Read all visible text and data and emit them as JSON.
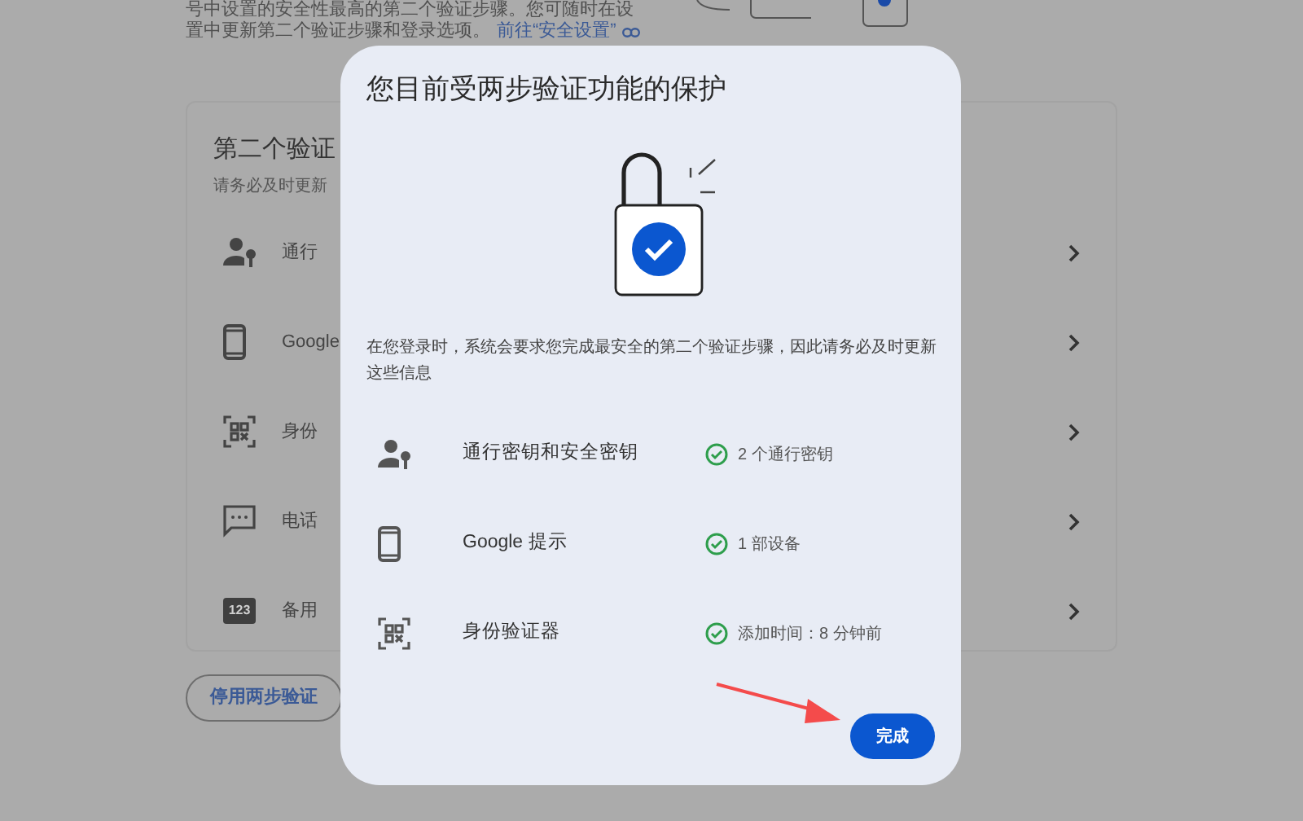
{
  "page": {
    "intro_lines": [
      "号中设置的安全性最高的第二个验证步骤。您可随时在设",
      "置中更新第二个验证步骤和登录选项。"
    ],
    "security_link": "前往“安全设置”",
    "section": {
      "title": "第二个验证",
      "subtitle": "请务必及时更新",
      "items": [
        {
          "kind": "passkey",
          "label": "通行"
        },
        {
          "kind": "phone",
          "label": "Google"
        },
        {
          "kind": "authenticator",
          "label": "身份"
        },
        {
          "kind": "message",
          "label": "电话"
        },
        {
          "kind": "backup",
          "label": "备用",
          "badge": "123"
        }
      ]
    },
    "disable_button": "停用两步验证"
  },
  "dialog": {
    "title": "您目前受两步验证功能的保护",
    "description": "在您登录时，系统会要求您完成最安全的第二个验证步骤，因此请务必及时更新这些信息",
    "methods": [
      {
        "kind": "passkey",
        "label": "通行密钥和安全密钥",
        "status": "2 个通行密钥"
      },
      {
        "kind": "phone",
        "label": "Google 提示",
        "status": "1 部设备"
      },
      {
        "kind": "authenticator",
        "label": "身份验证器",
        "status": "添加时间：8 分钟前"
      }
    ],
    "done_button": "完成"
  }
}
